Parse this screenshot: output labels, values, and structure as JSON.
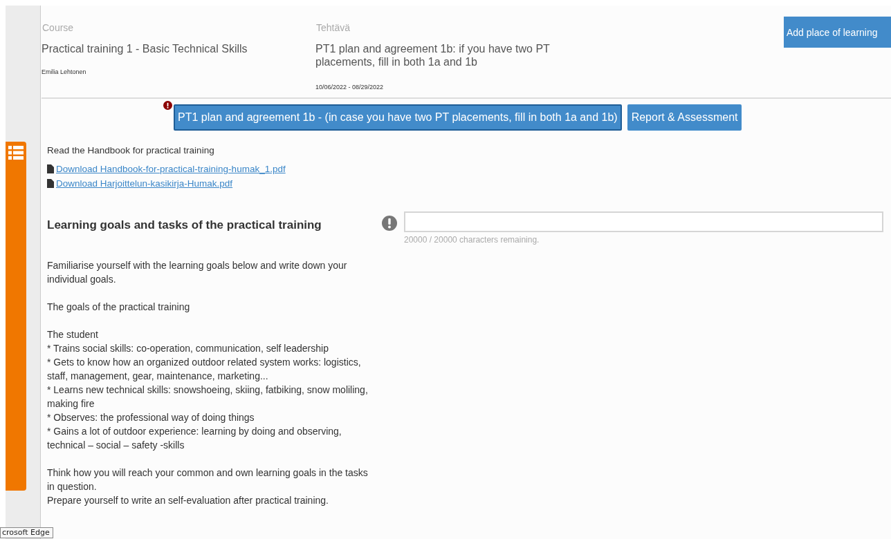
{
  "header": {
    "course_label": "Course",
    "course_title": "Practical training 1 - Basic Technical Skills",
    "student": "Emilia Lehtonen",
    "task_label": "Tehtävä",
    "task_title": "PT1 plan and agreement 1b: if you have two PT placements, fill in both 1a and 1b",
    "dates": "10/06/2022 - 08/29/2022",
    "add_button": "Add place of learning"
  },
  "tabs": [
    {
      "label": "PT1 plan and agreement 1b - (in case you have two PT placements, fill in both 1a and 1b)",
      "selected": true,
      "error": true
    },
    {
      "label": "Report & Assessment",
      "selected": false,
      "error": false
    }
  ],
  "intro": "Read the Handbook for practical training",
  "downloads": [
    " Download Handbook-for-practical-training-humak_1.pdf",
    " Download Harjoittelun-kasikirja-Humak.pdf"
  ],
  "section": {
    "heading": "Learning goals and tasks of the practical training",
    "counter": "20000 / 20000 characters remaining.",
    "paragraphs": [
      [
        "Familiarise yourself with the learning goals below and write down your individual goals."
      ],
      [
        "The goals of the practical training"
      ],
      [
        "The student",
        "* Trains social skills: co-operation, communication, self leadership",
        "* Gets to know how an organized outdoor related system works: logistics, staff, management, gear, maintenance, marketing...",
        "* Learns new technical skills: snowshoeing, skiing, fatbiking, snow moliling, making fire",
        "* Observes: the professional way of doing things",
        "* Gains a lot of outdoor experience: learning by doing and observing, technical – social – safety -skills"
      ],
      [
        "Think how you will reach your common and own learning goals in the tasks in question.",
        "Prepare yourself to write an self-evaluation after practical training."
      ]
    ]
  },
  "tooltip": "crosoft Edge"
}
